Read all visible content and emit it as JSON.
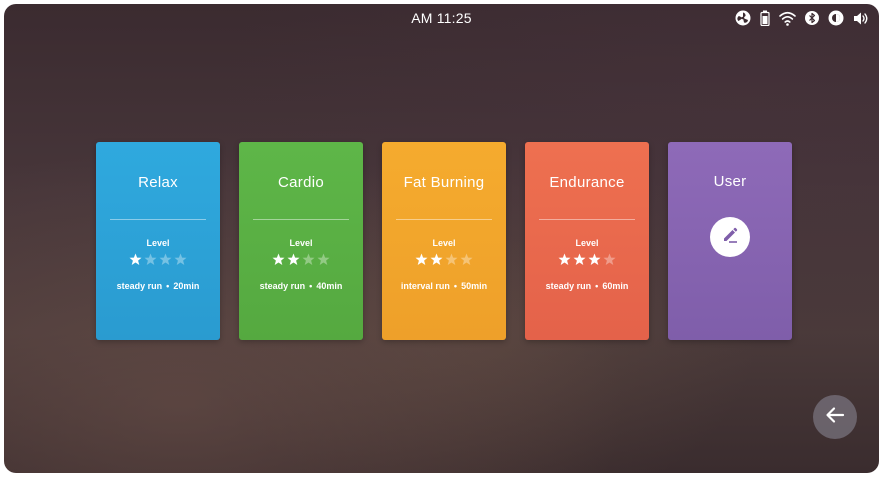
{
  "status_bar": {
    "time": "AM 11:25",
    "icons": [
      "fan-icon",
      "battery-icon",
      "wifi-icon",
      "bluetooth-icon",
      "brightness-icon",
      "volume-icon"
    ]
  },
  "workouts": [
    {
      "title": "Relax",
      "level_label": "Level",
      "level": 1,
      "max_level": 4,
      "type": "steady run",
      "duration": "20min",
      "color": "#2aa3d8"
    },
    {
      "title": "Cardio",
      "level_label": "Level",
      "level": 2,
      "max_level": 4,
      "type": "steady run",
      "duration": "40min",
      "color": "#5ab244"
    },
    {
      "title": "Fat Burning",
      "level_label": "Level",
      "level": 2,
      "max_level": 4,
      "type": "interval run",
      "duration": "50min",
      "color": "#f2a52c"
    },
    {
      "title": "Endurance",
      "level_label": "Level",
      "level": 3,
      "max_level": 4,
      "type": "steady run",
      "duration": "60min",
      "color": "#ea6a4c"
    }
  ],
  "user_card": {
    "title": "User",
    "color": "#8b67b4",
    "icon": "pencil-icon"
  },
  "separator": "•",
  "back_button": {
    "icon": "arrow-left-icon"
  }
}
